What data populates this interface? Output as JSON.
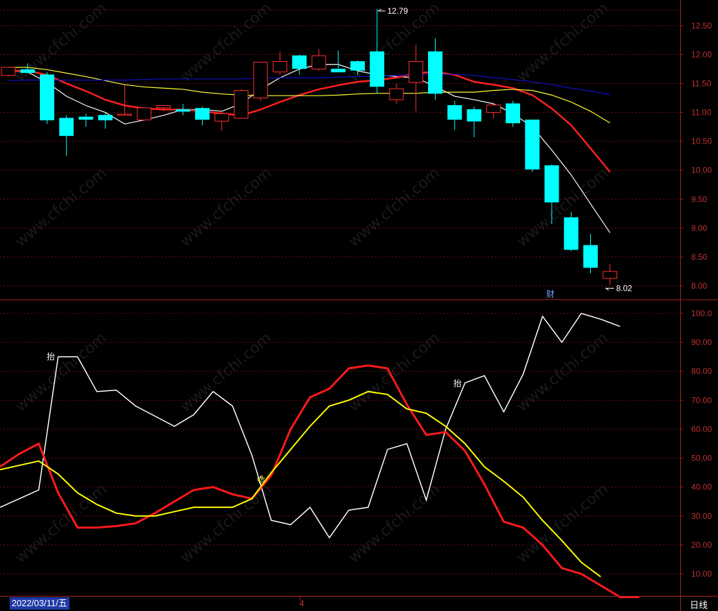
{
  "chart_data": [
    {
      "type": "candlestick",
      "ylim": [
        7.8,
        12.8
      ],
      "yticks": [
        "12.50",
        "12.00",
        "11.50",
        "11.00",
        "10.50",
        "10.00",
        "9.50",
        "9.00",
        "8.50",
        "8.00"
      ],
      "max_annotation": "12.79",
      "min_annotation": "8.02",
      "event_marker": "财",
      "candles": [
        {
          "o": 11.64,
          "h": 11.78,
          "l": 11.62,
          "c": 11.78
        },
        {
          "o": 11.74,
          "h": 11.85,
          "l": 11.67,
          "c": 11.69
        },
        {
          "o": 11.65,
          "h": 11.7,
          "l": 10.8,
          "c": 10.87
        },
        {
          "o": 10.9,
          "h": 10.95,
          "l": 10.25,
          "c": 10.6
        },
        {
          "o": 10.92,
          "h": 10.98,
          "l": 10.75,
          "c": 10.88
        },
        {
          "o": 10.95,
          "h": 11.0,
          "l": 10.72,
          "c": 10.87
        },
        {
          "o": 10.95,
          "h": 11.47,
          "l": 10.95,
          "c": 10.97
        },
        {
          "o": 10.87,
          "h": 11.08,
          "l": 10.85,
          "c": 11.08
        },
        {
          "o": 11.08,
          "h": 11.12,
          "l": 11.02,
          "c": 11.12
        },
        {
          "o": 11.05,
          "h": 11.15,
          "l": 10.95,
          "c": 11.02
        },
        {
          "o": 11.07,
          "h": 11.1,
          "l": 10.78,
          "c": 10.88
        },
        {
          "o": 10.85,
          "h": 11.0,
          "l": 10.68,
          "c": 10.98
        },
        {
          "o": 10.9,
          "h": 11.4,
          "l": 10.9,
          "c": 11.38
        },
        {
          "o": 11.25,
          "h": 11.87,
          "l": 11.2,
          "c": 11.87
        },
        {
          "o": 11.7,
          "h": 12.05,
          "l": 11.65,
          "c": 11.88
        },
        {
          "o": 11.98,
          "h": 12.0,
          "l": 11.65,
          "c": 11.76
        },
        {
          "o": 11.75,
          "h": 12.1,
          "l": 11.72,
          "c": 11.98
        },
        {
          "o": 11.75,
          "h": 12.07,
          "l": 11.72,
          "c": 11.7
        },
        {
          "o": 11.88,
          "h": 11.9,
          "l": 11.65,
          "c": 11.73
        },
        {
          "o": 12.05,
          "h": 12.79,
          "l": 11.33,
          "c": 11.45
        },
        {
          "o": 11.22,
          "h": 11.5,
          "l": 11.15,
          "c": 11.41
        },
        {
          "o": 11.52,
          "h": 12.17,
          "l": 11.02,
          "c": 11.88
        },
        {
          "o": 12.05,
          "h": 12.28,
          "l": 11.22,
          "c": 11.33
        },
        {
          "o": 11.12,
          "h": 11.2,
          "l": 10.7,
          "c": 10.88
        },
        {
          "o": 11.05,
          "h": 11.1,
          "l": 10.57,
          "c": 10.85
        },
        {
          "o": 11.0,
          "h": 11.18,
          "l": 10.9,
          "c": 11.13
        },
        {
          "o": 11.15,
          "h": 11.2,
          "l": 10.75,
          "c": 10.82
        },
        {
          "o": 10.87,
          "h": 10.87,
          "l": 9.97,
          "c": 10.02
        },
        {
          "o": 10.08,
          "h": 10.1,
          "l": 9.07,
          "c": 9.45
        },
        {
          "o": 9.18,
          "h": 9.28,
          "l": 8.6,
          "c": 8.63
        },
        {
          "o": 8.7,
          "h": 8.9,
          "l": 8.22,
          "c": 8.32
        },
        {
          "o": 8.13,
          "h": 8.38,
          "l": 8.02,
          "c": 8.25
        }
      ],
      "ma_lines": [
        {
          "color": "#ffffff",
          "values": [
            11.72,
            11.7,
            11.52,
            11.28,
            11.12,
            11.0,
            10.8,
            10.87,
            10.95,
            11.05,
            11.05,
            11.02,
            11.15,
            11.4,
            11.6,
            11.75,
            11.83,
            11.83,
            11.72,
            11.65,
            11.62,
            11.6,
            11.45,
            11.28,
            11.22,
            11.15,
            10.98,
            10.75,
            10.35,
            9.92,
            9.42,
            8.92
          ]
        },
        {
          "color": "#ff2020",
          "values": [
            11.72,
            11.72,
            11.65,
            11.5,
            11.37,
            11.22,
            11.12,
            11.07,
            11.05,
            11.05,
            11.02,
            10.98,
            10.95,
            11.05,
            11.18,
            11.3,
            11.4,
            11.47,
            11.53,
            11.56,
            11.6,
            11.68,
            11.7,
            11.65,
            11.53,
            11.48,
            11.42,
            11.3,
            11.07,
            10.78,
            10.38,
            9.97
          ]
        },
        {
          "color": "#ffff33",
          "values": [
            11.78,
            11.78,
            11.74,
            11.68,
            11.62,
            11.55,
            11.48,
            11.44,
            11.42,
            11.4,
            11.35,
            11.32,
            11.3,
            11.29,
            11.29,
            11.29,
            11.29,
            11.3,
            11.32,
            11.33,
            11.33,
            11.33,
            11.35,
            11.35,
            11.35,
            11.38,
            11.4,
            11.38,
            11.3,
            11.18,
            11.02,
            10.82
          ]
        },
        {
          "color": "#1010c0",
          "values": [
            11.55,
            11.56,
            11.56,
            11.56,
            11.56,
            11.56,
            11.56,
            11.57,
            11.58,
            11.58,
            11.58,
            11.58,
            11.58,
            11.59,
            11.6,
            11.6,
            11.6,
            11.61,
            11.62,
            11.63,
            11.64,
            11.65,
            11.66,
            11.66,
            11.64,
            11.6,
            11.57,
            11.53,
            11.48,
            11.42,
            11.37,
            11.31
          ]
        }
      ]
    },
    {
      "type": "line",
      "ylim": [
        0,
        102
      ],
      "yticks": [
        "100.0",
        "90.00",
        "80.00",
        "70.00",
        "60.00",
        "50.00",
        "40.00",
        "30.00",
        "20.00",
        "10.00"
      ],
      "series": [
        {
          "color": "#ffffff",
          "values": [
            33,
            36,
            39,
            85,
            85,
            73,
            73.5,
            68,
            64.5,
            61,
            65,
            73,
            68,
            51,
            28.5,
            27,
            33,
            22.5,
            32,
            33,
            53,
            55,
            35.5,
            60,
            76,
            78.5,
            66,
            79,
            99,
            90,
            100,
            98,
            95.5
          ]
        },
        {
          "color": "#ff1a1a",
          "values": [
            47,
            51.5,
            55,
            38,
            26,
            26,
            26.5,
            27.5,
            31,
            35,
            39,
            40,
            37.5,
            36,
            44,
            60,
            71,
            74,
            81,
            82,
            81,
            68.5,
            58,
            59,
            52.5,
            41,
            28,
            26,
            20,
            12,
            10,
            6,
            2,
            2
          ]
        },
        {
          "color": "#ffff00",
          "values": [
            46,
            47.5,
            49,
            44.5,
            38,
            34,
            31,
            30,
            30,
            31.5,
            33,
            33,
            33,
            36,
            45,
            53,
            61,
            68,
            70,
            73,
            72,
            67,
            65.5,
            61,
            55,
            47,
            42,
            36.5,
            28.5,
            21.5,
            14,
            9
          ]
        }
      ],
      "markers": [
        {
          "text": "抬",
          "color": "#ffffff"
        },
        {
          "text": "抬",
          "color": "#ffffff"
        },
        {
          "text": "终",
          "color": "#ffff66"
        }
      ]
    }
  ],
  "footer": {
    "date": "2022/03/11/五",
    "month_mark": "4",
    "period": "日线"
  },
  "watermark": "www.cfchi.com"
}
